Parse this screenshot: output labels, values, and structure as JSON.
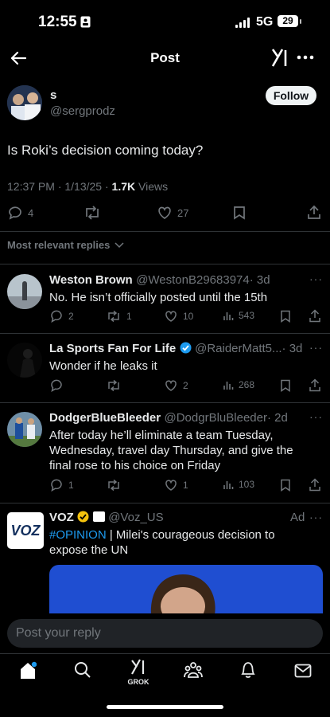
{
  "status_bar": {
    "time": "12:55",
    "network": "5G",
    "battery": "29"
  },
  "header": {
    "title": "Post"
  },
  "post": {
    "author_name": "s",
    "handle": "@sergprodz",
    "follow_label": "Follow",
    "text": "Is Roki’s decision coming today?",
    "timestamp": "12:37 PM · 1/13/25 · ",
    "views_count": "1.7K",
    "views_label": " Views",
    "replies": "4",
    "likes": "27"
  },
  "replies_filter": {
    "label": "Most relevant replies"
  },
  "replies": [
    {
      "name": "Weston Brown",
      "handle": "@WestonB29683974",
      "time": "· 3d",
      "text": "No. He isn’t officially posted until the 15th",
      "replies": "2",
      "reposts": "1",
      "likes": "10",
      "views": "543"
    },
    {
      "name": "La Sports Fan For Life",
      "handle": "@RaiderMatt5...",
      "time": "· 3d",
      "text": "Wonder if he leaks it",
      "replies": "",
      "reposts": "",
      "likes": "2",
      "views": "268"
    },
    {
      "name": "DodgerBlueBleeder",
      "handle": "@DodgrBluBleeder",
      "time": "· 2d",
      "text": "After today he’ll eliminate a team Tuesday, Wednesday, travel day Thursday, and give the final rose to his choice on Friday",
      "replies": "1",
      "reposts": "",
      "likes": "1",
      "views": "103"
    }
  ],
  "ad": {
    "name": "VOZ",
    "handle": "@Voz_US",
    "ad_label": "Ad",
    "hashtag": "#OPINION",
    "text": " | Milei's courageous decision to expose the UN",
    "logo_text": "VOZ"
  },
  "composer": {
    "placeholder": "Post your reply"
  },
  "tabbar": {
    "grok_label": "GROK"
  },
  "colors": {
    "accent": "#1d9bf0",
    "verified": "#f4c20d",
    "muted": "#71767b"
  }
}
